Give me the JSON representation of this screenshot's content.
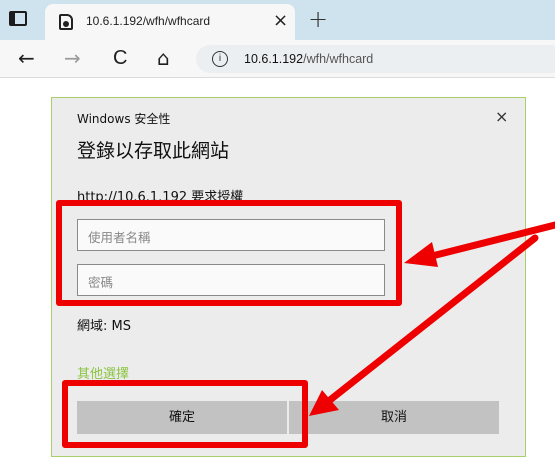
{
  "browser": {
    "tab_title": "10.6.1.192/wfh/wfhcard",
    "tab_close": "×",
    "new_tab": "+",
    "address": {
      "host": "10.6.1.192",
      "path": "/wfh/wfhcard"
    },
    "nav": {
      "back": "←",
      "forward": "→",
      "reload": "C",
      "home": "⌂",
      "info": "i"
    }
  },
  "dialog": {
    "caption": "Windows 安全性",
    "close": "×",
    "title": "登錄以存取此網站",
    "auth_message": "http://10.6.1.192 要求授權",
    "username_placeholder": "使用者名稱",
    "password_placeholder": "密碼",
    "domain": "網域: MS",
    "more_options": "其他選擇",
    "ok_label": "確定",
    "cancel_label": "取消"
  },
  "colors": {
    "highlight": "#ee0000",
    "link": "#8ac43f"
  }
}
